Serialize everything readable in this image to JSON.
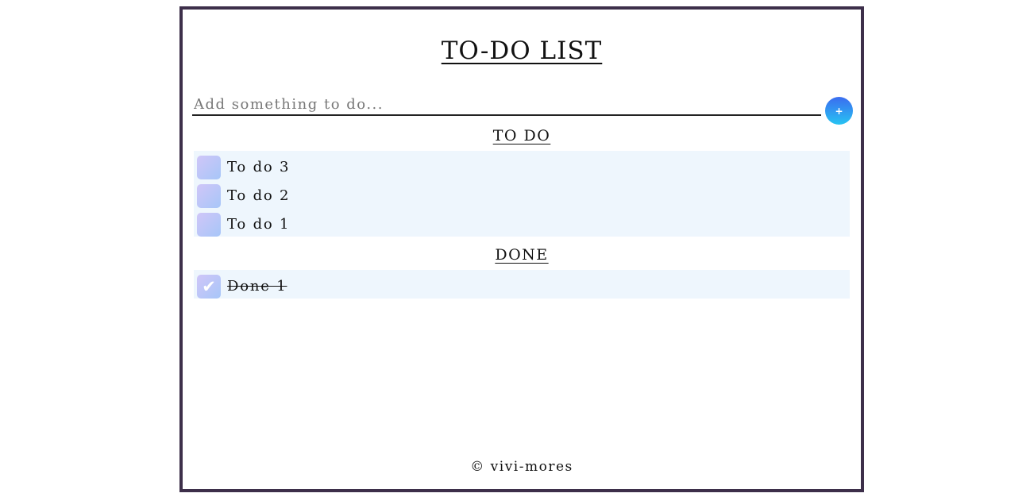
{
  "app": {
    "title": "TO-DO LIST"
  },
  "add": {
    "placeholder": "Add something to do...",
    "value": "",
    "button_label": "+"
  },
  "sections": {
    "todo": {
      "heading": "TO DO",
      "items": [
        {
          "label": "To do 3",
          "checked": false
        },
        {
          "label": "To do 2",
          "checked": false
        },
        {
          "label": "To do 1",
          "checked": false
        }
      ]
    },
    "done": {
      "heading": "DONE",
      "items": [
        {
          "label": "Done 1",
          "checked": true,
          "check_icon": "✔"
        }
      ]
    }
  },
  "footer": {
    "text": "© vivi-mores"
  },
  "colors": {
    "border": "#3d2f4a",
    "list_background": "#eef6fd",
    "button_gradient_top": "#3b6cf0",
    "button_gradient_bottom": "#27c4f2",
    "checkbox_gradient_start": "#d0c6f8",
    "checkbox_gradient_end": "#a7c6f8"
  },
  "icons": {
    "add": "plus-icon",
    "checked": "checkmark-icon"
  }
}
